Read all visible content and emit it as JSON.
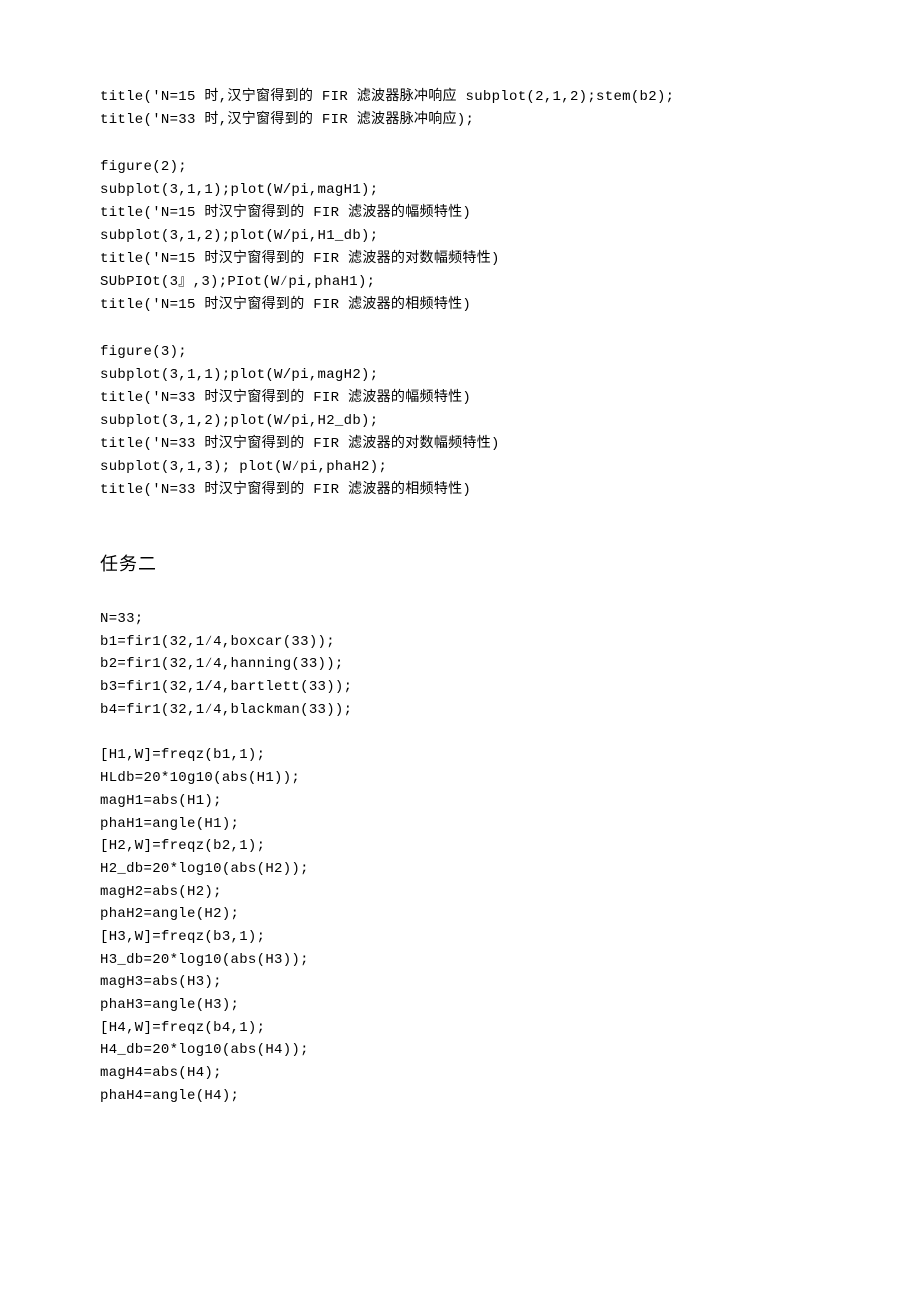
{
  "block1": {
    "l1": "title('N=15 时,汉宁窗得到的 FIR 滤波器脉冲响应 subplot(2,1,2);stem(b2);",
    "l2": "title('N=33 时,汉宁窗得到的 FIR 滤波器脉冲响应);"
  },
  "block2": {
    "l1": "figure(2);",
    "l2": "subplot(3,1,1);plot(W/pi,magH1);",
    "l3": "title('N=15 时汉宁窗得到的 FIR 滤波器的幅频特性)",
    "l4": "subplot(3,1,2);plot(W/pi,H1_db);",
    "l5": "title('N=15 时汉宁窗得到的 FIR 滤波器的对数幅频特性)",
    "l6": "SUbPIOt(3』,3);PIot(W∕pi,phaH1);",
    "l7": "title('N=15 时汉宁窗得到的 FIR 滤波器的相频特性)"
  },
  "block3": {
    "l1": "figure(3);",
    "l2": "subplot(3,1,1);plot(W/pi,magH2);",
    "l3": "title('N=33 时汉宁窗得到的 FIR 滤波器的幅频特性)",
    "l4": "subplot(3,1,2);plot(W/pi,H2_db);",
    "l5": "title('N=33 时汉宁窗得到的 FIR 滤波器的对数幅频特性)",
    "l6": "subplot(3,1,3); plot(W∕pi,phaH2);",
    "l7": "title('N=33 时汉宁窗得到的 FIR 滤波器的相频特性)"
  },
  "heading": "任务二",
  "block4": {
    "l1": "N=33;",
    "l2": "b1=fir1(32,1∕4,boxcar(33));",
    "l3": "b2=fir1(32,1∕4,hanning(33));",
    "l4": "b3=fir1(32,1/4,bartlett(33));",
    "l5": "b4=fir1(32,1∕4,blackman(33));"
  },
  "block5": {
    "l1": "[H1,W]=freqz(b1,1);",
    "l2": "HLdb=20*10g10(abs(H1));",
    "l3": "magH1=abs(H1);",
    "l4": "phaH1=angle(H1);",
    "l5": "[H2,W]=freqz(b2,1);",
    "l6": "H2_db=20*log10(abs(H2));",
    "l7": "magH2=abs(H2);",
    "l8": "phaH2=angle(H2);",
    "l9": "[H3,W]=freqz(b3,1);",
    "l10": "H3_db=20*log10(abs(H3));",
    "l11": "magH3=abs(H3);",
    "l12": "phaH3=angle(H3);",
    "l13": "[H4,W]=freqz(b4,1);",
    "l14": "H4_db=20*log10(abs(H4));",
    "l15": "magH4=abs(H4);",
    "l16": "phaH4=angle(H4);"
  }
}
